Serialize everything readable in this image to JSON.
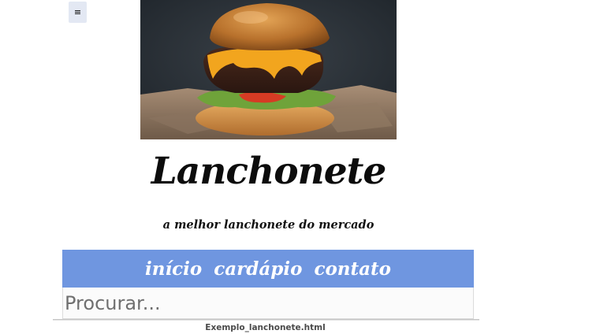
{
  "menu": {
    "icon": "hamburger-menu-icon",
    "glyph": "≡"
  },
  "hero": {
    "image": "burger-photo"
  },
  "brand": {
    "title": "Lanchonete",
    "tagline": "a melhor lanchonete do mercado"
  },
  "nav": {
    "items": [
      {
        "label": "início"
      },
      {
        "label": "cardápio"
      },
      {
        "label": "contato"
      }
    ],
    "background": "#6f96e0"
  },
  "search": {
    "placeholder": "Procurar...",
    "value": ""
  },
  "footer": {
    "filename": "Exemplo_lanchonete.html"
  }
}
